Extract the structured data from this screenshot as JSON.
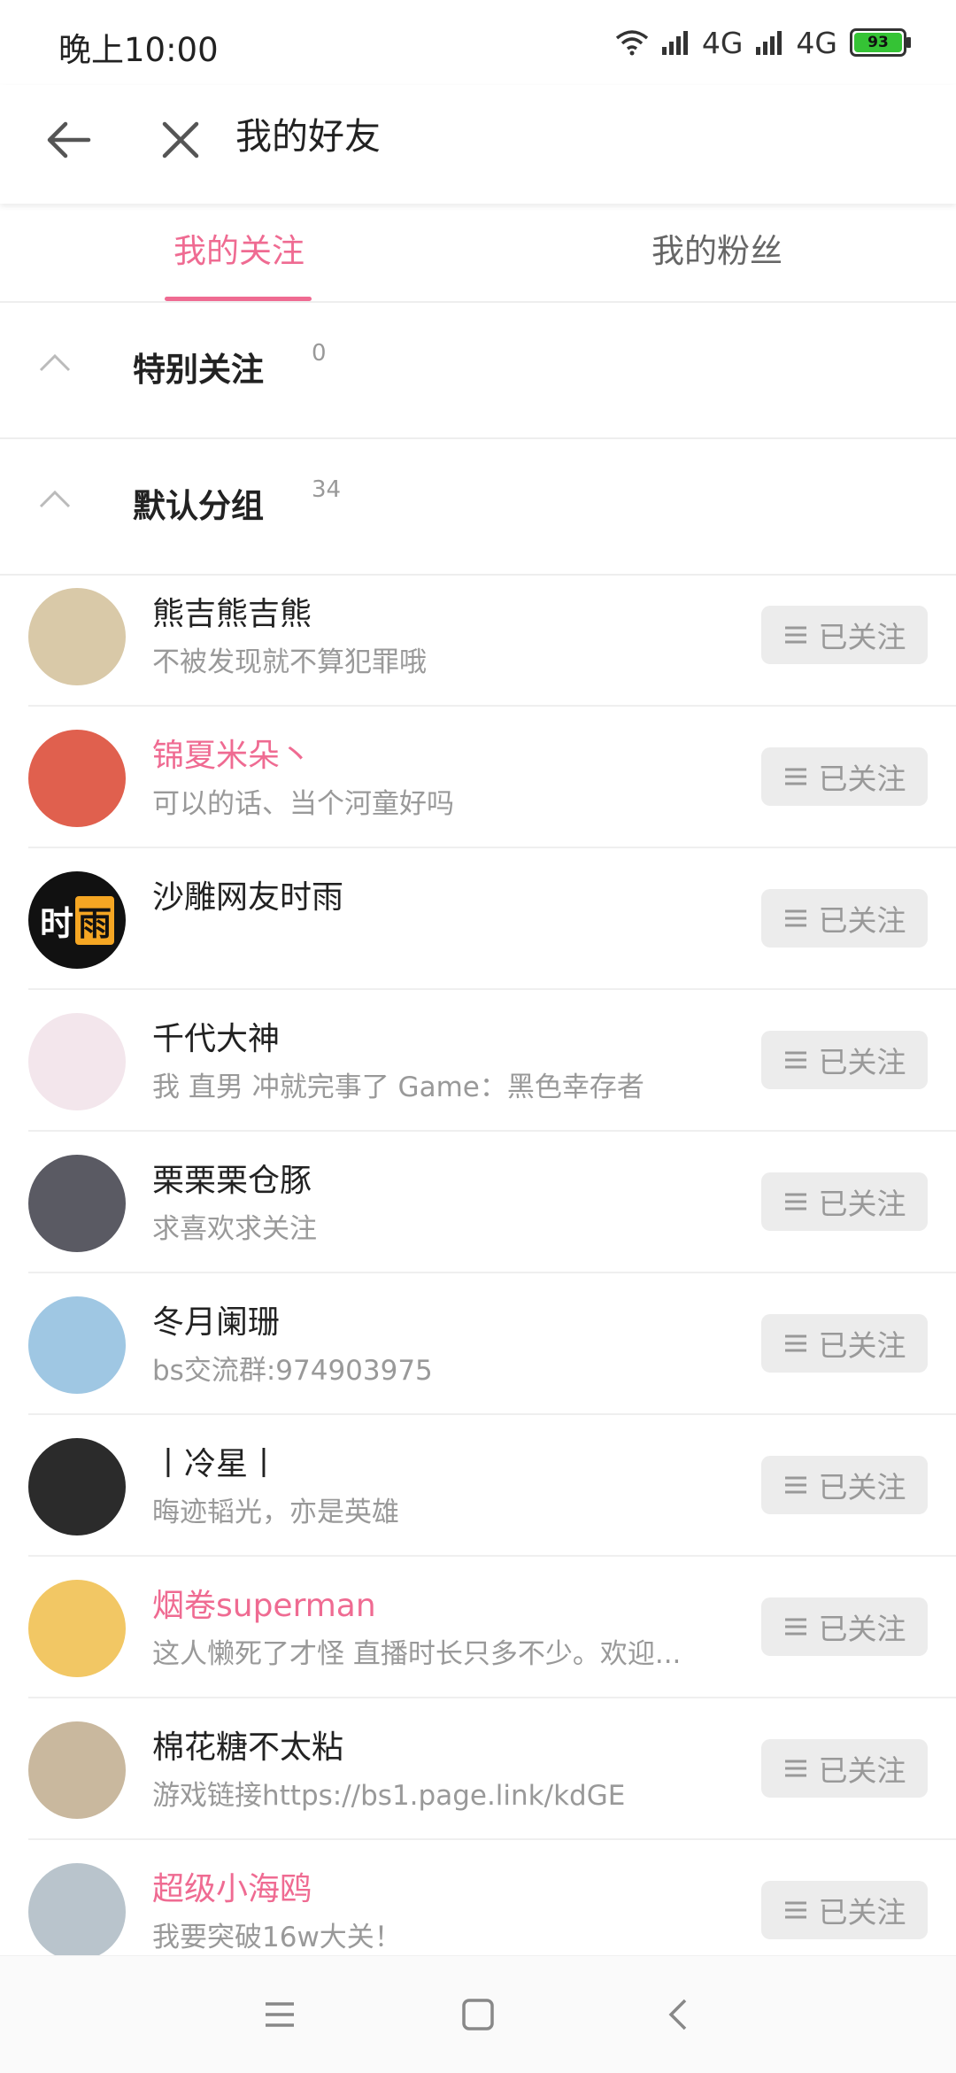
{
  "status": {
    "time": "晚上10:00",
    "net1": "4G",
    "net2": "4G",
    "battery": "93",
    "battery_level": 0.93
  },
  "header": {
    "title": "我的好友"
  },
  "tabs": [
    {
      "label": "我的关注",
      "active": true
    },
    {
      "label": "我的粉丝",
      "active": false
    }
  ],
  "groups": [
    {
      "name": "特别关注",
      "count": "0"
    },
    {
      "name": "默认分组",
      "count": "34"
    }
  ],
  "follow_label": "已关注",
  "users": [
    {
      "name": "熊吉熊吉熊",
      "sig": "不被发现就不算犯罪哦",
      "pink": false,
      "avatar_color": "#d9c9a8"
    },
    {
      "name": "锦夏米朵丶",
      "sig": "可以的话、当个河童好吗",
      "pink": true,
      "avatar_color": "#e0604e"
    },
    {
      "name": "沙雕网友时雨",
      "sig": "",
      "pink": false,
      "avatar_color": "#111111",
      "avatar_text": [
        "时",
        "雨"
      ]
    },
    {
      "name": "千代大神",
      "sig": "我 直男 冲就完事了 Game：黑色幸存者",
      "pink": false,
      "avatar_color": "#f3e6ec"
    },
    {
      "name": "栗栗栗仓豚",
      "sig": "求喜欢求关注",
      "pink": false,
      "avatar_color": "#5a5a63"
    },
    {
      "name": "冬月阑珊",
      "sig": "bs交流群:974903975",
      "pink": false,
      "avatar_color": "#9fc7e3"
    },
    {
      "name": "丨冷星丨",
      "sig": "晦迹韬光，亦是英雄",
      "pink": false,
      "avatar_color": "#2b2b2b"
    },
    {
      "name": "烟卷superman",
      "sig": "这人懒死了才怪 直播时长只多不少。欢迎...",
      "pink": true,
      "avatar_color": "#f2c764"
    },
    {
      "name": "棉花糖不太粘",
      "sig": "游戏链接https://bs1.page.link/kdGE",
      "pink": false,
      "avatar_color": "#c9b89e"
    },
    {
      "name": "超级小海鸥",
      "sig": "我要突破16w大关！",
      "pink": true,
      "avatar_color": "#b9c4cc"
    }
  ],
  "colors": {
    "accent": "#ef6b92",
    "button_bg": "#ececec"
  },
  "icons": {
    "back": "arrow-left-icon",
    "close": "close-icon",
    "collapse": "chevron-up-icon",
    "menu": "menu-lines-icon"
  }
}
